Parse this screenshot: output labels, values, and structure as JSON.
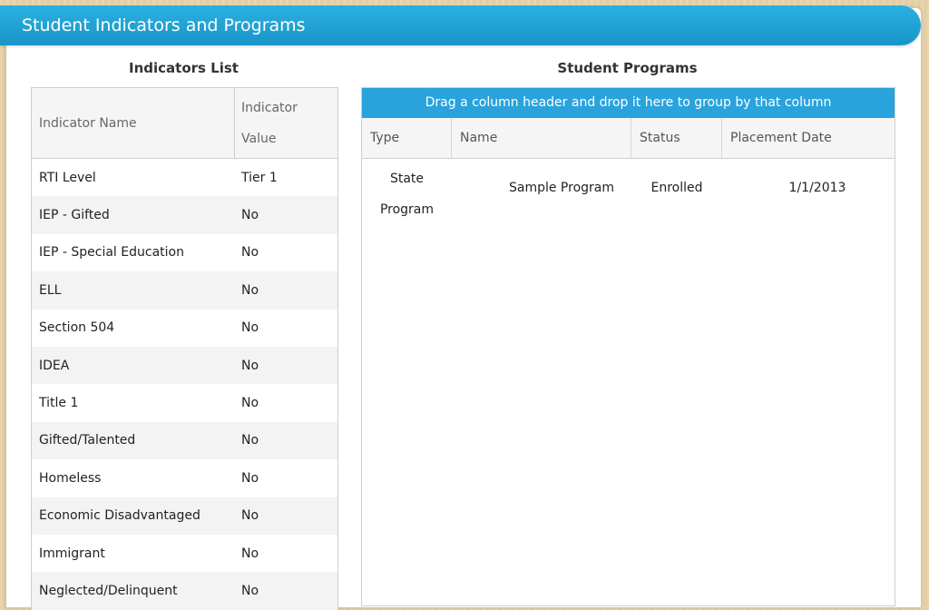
{
  "header": {
    "title": "Student Indicators and Programs"
  },
  "indicators": {
    "title": "Indicators List",
    "col_name": "Indicator Name",
    "col_value_line1": "Indicator",
    "col_value_line2": "Value",
    "rows": [
      {
        "name": "RTI Level",
        "value": "Tier 1"
      },
      {
        "name": "IEP - Gifted",
        "value": "No"
      },
      {
        "name": "IEP - Special Education",
        "value": "No"
      },
      {
        "name": "ELL",
        "value": "No"
      },
      {
        "name": "Section 504",
        "value": "No"
      },
      {
        "name": "IDEA",
        "value": "No"
      },
      {
        "name": "Title 1",
        "value": "No"
      },
      {
        "name": "Gifted/Talented",
        "value": "No"
      },
      {
        "name": "Homeless",
        "value": "No"
      },
      {
        "name": "Economic Disadvantaged",
        "value": "No"
      },
      {
        "name": "Immigrant",
        "value": "No"
      },
      {
        "name": "Neglected/Delinquent",
        "value": "No"
      }
    ]
  },
  "programs": {
    "title": "Student Programs",
    "group_hint": "Drag a column header and drop it here to group by that column",
    "columns": {
      "type": "Type",
      "name": "Name",
      "status": "Status",
      "date": "Placement Date"
    },
    "rows": [
      {
        "type_line1": "State",
        "type_line2": "Program",
        "name": "Sample Program",
        "status": "Enrolled",
        "date": "1/1/2013"
      }
    ]
  }
}
